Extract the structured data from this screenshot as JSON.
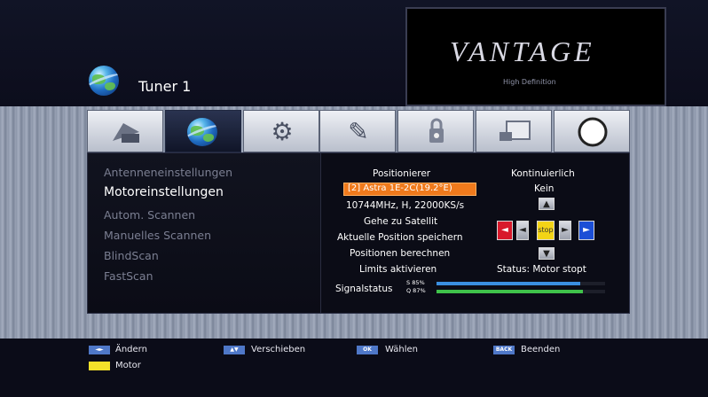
{
  "header": {
    "title": "Tuner 1",
    "logo_text": "VANTAGE",
    "logo_sub": "High Definition"
  },
  "tabs": [
    {
      "icon": "satellite-dish-icon"
    },
    {
      "icon": "globe-icon",
      "active": true
    },
    {
      "icon": "gears-icon"
    },
    {
      "icon": "pencil-icon"
    },
    {
      "icon": "lock-icon"
    },
    {
      "icon": "monitor-icon"
    },
    {
      "icon": "circle-icon"
    }
  ],
  "menu": {
    "items": [
      {
        "label": "Antenneneinstellungen"
      },
      {
        "label": "Motoreinstellungen",
        "selected": true
      },
      {
        "label": "Autom. Scannen"
      },
      {
        "label": "Manuelles Scannen"
      },
      {
        "label": "BlindScan"
      },
      {
        "label": "FastScan"
      }
    ]
  },
  "motor": {
    "positioner_label": "Positionierer",
    "mode_label": "Kontinuierlich",
    "satellite": "[2] Astra 1E-2C(19.2°E)",
    "mode_value": "Kein",
    "transponder": "10744MHz, H, 22000KS/s",
    "goto_satellite": "Gehe zu Satellit",
    "save_position": "Aktuelle Position speichern",
    "calc_positions": "Positionen berechnen",
    "enable_limits": "Limits aktivieren",
    "status": "Status:  Motor stopt",
    "signal_label": "Signalstatus",
    "strength_label": "S 85%",
    "quality_label": "Q 87%",
    "strength": 85,
    "quality": 87,
    "pad_center": "stop"
  },
  "footer": {
    "items": [
      {
        "key": "◄►",
        "label": "Ändern"
      },
      {
        "key": "▲▼",
        "label": "Verschieben"
      },
      {
        "key": "OK",
        "label": "Wählen"
      },
      {
        "key": "BACK",
        "label": "Beenden"
      },
      {
        "key": "",
        "label": "Motor"
      }
    ]
  },
  "colors": {
    "highlight": "#f07a1c",
    "strength_bar": "#3a8fe0",
    "quality_bar": "#3fc24a"
  }
}
